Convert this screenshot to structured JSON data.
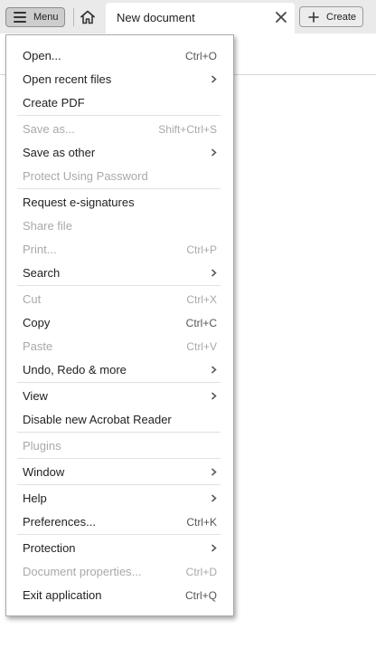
{
  "topbar": {
    "menu_label": "Menu",
    "tab_title": "New document",
    "create_label": "Create",
    "icons": {
      "menu": "hamburger-icon",
      "home": "home-icon",
      "close": "close-icon",
      "create": "plus-icon"
    }
  },
  "menu": {
    "items": [
      {
        "label": "Open...",
        "shortcut": "Ctrl+O",
        "enabled": true,
        "submenu": false
      },
      {
        "label": "Open recent files",
        "shortcut": "",
        "enabled": true,
        "submenu": true
      },
      {
        "label": "Create PDF",
        "shortcut": "",
        "enabled": true,
        "submenu": false
      },
      {
        "label": "Save as...",
        "shortcut": "Shift+Ctrl+S",
        "enabled": false,
        "submenu": false
      },
      {
        "label": "Save as other",
        "shortcut": "",
        "enabled": true,
        "submenu": true
      },
      {
        "label": "Protect Using Password",
        "shortcut": "",
        "enabled": false,
        "submenu": false
      },
      {
        "label": "Request e-signatures",
        "shortcut": "",
        "enabled": true,
        "submenu": false
      },
      {
        "label": "Share file",
        "shortcut": "",
        "enabled": false,
        "submenu": false
      },
      {
        "label": "Print...",
        "shortcut": "Ctrl+P",
        "enabled": false,
        "submenu": false
      },
      {
        "label": "Search",
        "shortcut": "",
        "enabled": true,
        "submenu": true
      },
      {
        "label": "Cut",
        "shortcut": "Ctrl+X",
        "enabled": false,
        "submenu": false
      },
      {
        "label": "Copy",
        "shortcut": "Ctrl+C",
        "enabled": true,
        "submenu": false
      },
      {
        "label": "Paste",
        "shortcut": "Ctrl+V",
        "enabled": false,
        "submenu": false
      },
      {
        "label": "Undo, Redo & more",
        "shortcut": "",
        "enabled": true,
        "submenu": true
      },
      {
        "label": "View",
        "shortcut": "",
        "enabled": true,
        "submenu": true
      },
      {
        "label": "Disable new Acrobat Reader",
        "shortcut": "",
        "enabled": true,
        "submenu": false
      },
      {
        "label": "Plugins",
        "shortcut": "",
        "enabled": false,
        "submenu": false
      },
      {
        "label": "Window",
        "shortcut": "",
        "enabled": true,
        "submenu": true
      },
      {
        "label": "Help",
        "shortcut": "",
        "enabled": true,
        "submenu": true
      },
      {
        "label": "Preferences...",
        "shortcut": "Ctrl+K",
        "enabled": true,
        "submenu": false
      },
      {
        "label": "Protection",
        "shortcut": "",
        "enabled": true,
        "submenu": true
      },
      {
        "label": "Document properties...",
        "shortcut": "Ctrl+D",
        "enabled": false,
        "submenu": false
      },
      {
        "label": "Exit application",
        "shortcut": "Ctrl+Q",
        "enabled": true,
        "submenu": false
      }
    ]
  },
  "colors": {
    "topbar_bg": "#eaeaea",
    "menu_button_bg": "#cdcdcd",
    "disabled_text": "#a9a9a9",
    "text": "#222222"
  }
}
